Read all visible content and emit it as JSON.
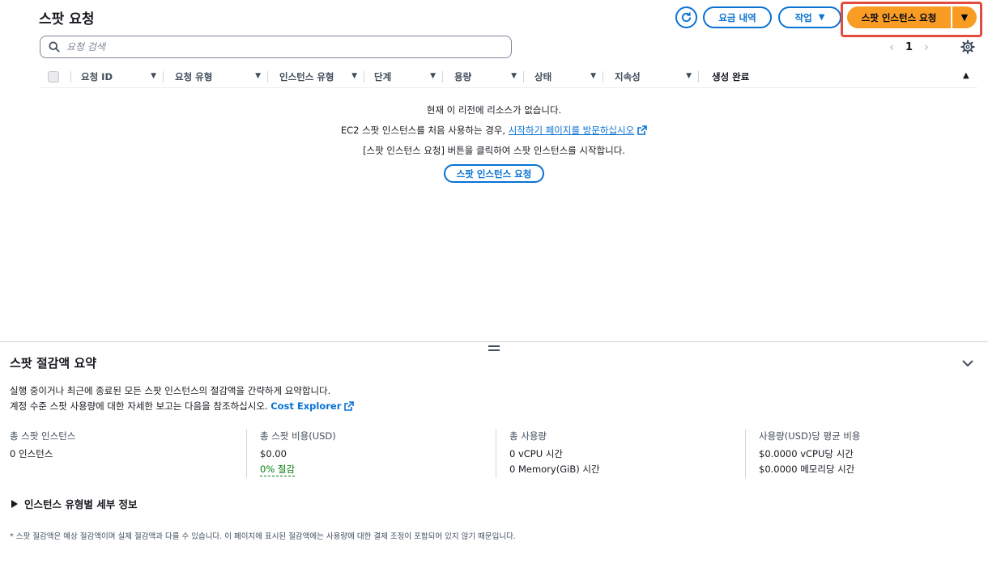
{
  "header": {
    "title": "스팟 요청",
    "billing_label": "요금 내역",
    "actions_label": "작업",
    "primary_label": "스팟 인스턴스 요청"
  },
  "search": {
    "placeholder": "요청 검색"
  },
  "pagination": {
    "current_page": "1"
  },
  "table": {
    "columns": [
      "요청 ID",
      "요청 유형",
      "인스턴스 유형",
      "단계",
      "용량",
      "상태",
      "지속성",
      "생성 완료"
    ]
  },
  "empty_state": {
    "line1": "현재 이 리전에 리소스가 없습니다.",
    "line2_prefix": "EC2 스팟 인스턴스를 처음 사용하는 경우, ",
    "line2_link": "시작하기 페이지를 방문하십시오",
    "line3": "[스팟 인스턴스 요청] 버튼을 클릭하여 스팟 인스턴스를 시작합니다.",
    "button_label": "스팟 인스턴스 요청"
  },
  "summary": {
    "title": "스팟 절감액 요약",
    "desc_line1": "실행 중이거나 최근에 종료된 모든 스팟 인스턴스의 절감액을 간략하게 요약합니다.",
    "desc_line2_prefix": "계정 수준 스팟 사용량에 대한 자세한 보고는 다음을 참조하십시오. ",
    "desc_line2_link": "Cost Explorer",
    "metrics": [
      {
        "label": "총 스팟 인스턴스",
        "values": [
          "0 인스턴스"
        ]
      },
      {
        "label": "총 스팟 비용(USD)",
        "values": [
          "$0.00"
        ],
        "savings": "0% 절감"
      },
      {
        "label": "총 사용량",
        "values": [
          "0 vCPU 시간",
          "0 Memory(GiB) 시간"
        ]
      },
      {
        "label": "사용량(USD)당 평균 비용",
        "values": [
          "$0.0000 vCPU당 시간",
          "$0.0000 메모리당 시간"
        ]
      }
    ],
    "details_label": "인스턴스 유형별 세부 정보",
    "footnote": "* 스팟 절감액은 예상 절감액이며 실제 절감액과 다를 수 있습니다. 이 페이지에 표시된 절감액에는 사용량에 대한 결제 조정이 포함되어 있지 않기 때문입니다."
  },
  "colors": {
    "accent": "#0972d3",
    "primary_button": "#f89c24",
    "highlight": "#e24c3f",
    "savings": "#037f0c"
  }
}
